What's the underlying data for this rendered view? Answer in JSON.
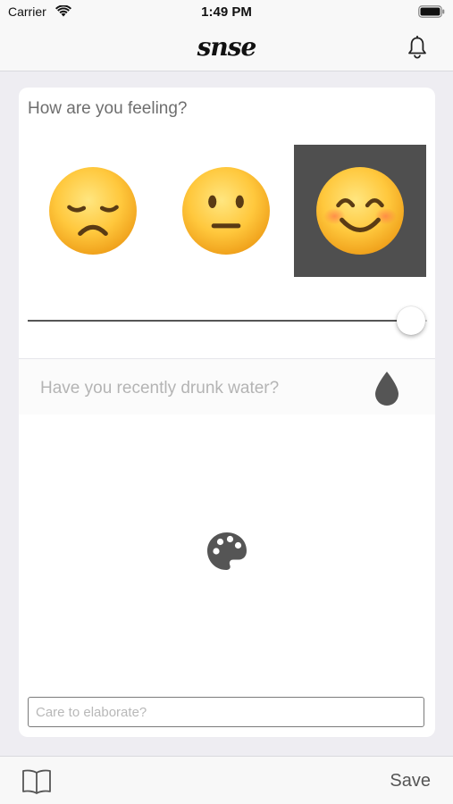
{
  "status_bar": {
    "carrier": "Carrier",
    "time": "1:49 PM",
    "icons": [
      "wifi-icon",
      "battery-icon"
    ]
  },
  "nav_bar": {
    "logo": "snse",
    "right_icon": "bell-icon"
  },
  "mood": {
    "question": "How are you feeling?",
    "options": [
      {
        "icon": "disappointed-face",
        "selected": false
      },
      {
        "icon": "neutral-face",
        "selected": false
      },
      {
        "icon": "smiling-face",
        "selected": true
      }
    ],
    "slider_value": 1.0
  },
  "water": {
    "question": "Have you recently drunk water?",
    "icon": "water-drop-icon"
  },
  "activity": {
    "icon": "palette-icon"
  },
  "elaborate": {
    "placeholder": "Care to elaborate?",
    "value": ""
  },
  "bottom_bar": {
    "left_icon": "book-icon",
    "save_label": "Save"
  },
  "colors": {
    "background": "#eeedf2",
    "selected_cell": "#4f4f4f",
    "emoji_yellow": "#ffc83d"
  }
}
